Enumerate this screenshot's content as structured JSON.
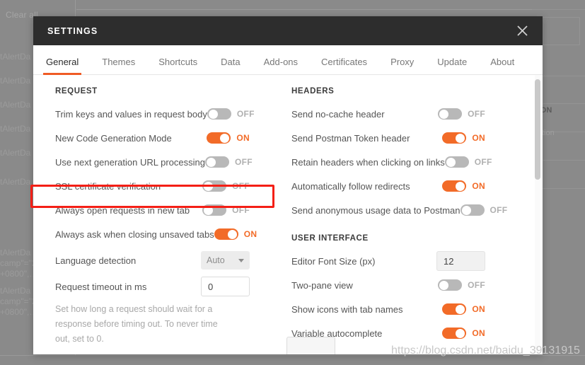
{
  "background": {
    "clear_all_label": "Clear all",
    "log_lines": [
      "tAlertDa",
      "tAlertDa",
      "tAlertDa",
      "tAlertDa",
      "tAlertDa",
      "tAlertDa",
      "camp\"=\"2",
      "+0800\",…",
      "tAlertDa",
      "camp\"=\"2",
      "+0800\",…"
    ],
    "right_bold_text": "TION",
    "right_norm_text": "tion"
  },
  "modal": {
    "title": "SETTINGS",
    "close_icon": "close-icon",
    "tabs": [
      {
        "label": "General",
        "active": true
      },
      {
        "label": "Themes",
        "active": false
      },
      {
        "label": "Shortcuts",
        "active": false
      },
      {
        "label": "Data",
        "active": false
      },
      {
        "label": "Add-ons",
        "active": false
      },
      {
        "label": "Certificates",
        "active": false
      },
      {
        "label": "Proxy",
        "active": false
      },
      {
        "label": "Update",
        "active": false
      },
      {
        "label": "About",
        "active": false
      }
    ],
    "left_column": {
      "section_title": "REQUEST",
      "rows": [
        {
          "label": "Trim keys and values in request body",
          "type": "toggle",
          "state": "OFF"
        },
        {
          "label": "New Code Generation Mode",
          "type": "toggle",
          "state": "ON"
        },
        {
          "label": "Use next generation URL processing",
          "type": "toggle",
          "state": "OFF"
        },
        {
          "label": "SSL certificate verification",
          "type": "toggle",
          "state": "OFF",
          "highlighted": true
        },
        {
          "label": "Always open requests in new tab",
          "type": "toggle",
          "state": "OFF"
        },
        {
          "label": "Always ask when closing unsaved tabs",
          "type": "toggle",
          "state": "ON"
        },
        {
          "label": "Language detection",
          "type": "select",
          "value": "Auto"
        },
        {
          "label": "Request timeout in ms",
          "type": "input",
          "value": "0"
        }
      ],
      "help_text": "Set how long a request should wait for a response before timing out. To never time out, set to 0."
    },
    "right_column": {
      "sections": [
        {
          "section_title": "HEADERS",
          "rows": [
            {
              "label": "Send no-cache header",
              "type": "toggle",
              "state": "OFF"
            },
            {
              "label": "Send Postman Token header",
              "type": "toggle",
              "state": "ON"
            },
            {
              "label": "Retain headers when clicking on links",
              "type": "toggle",
              "state": "OFF"
            },
            {
              "label": "Automatically follow redirects",
              "type": "toggle",
              "state": "ON"
            },
            {
              "label": "Send anonymous usage data to Postman",
              "type": "toggle",
              "state": "OFF"
            }
          ]
        },
        {
          "section_title": "USER INTERFACE",
          "rows": [
            {
              "label": "Editor Font Size (px)",
              "type": "input",
              "value": "12"
            },
            {
              "label": "Two-pane view",
              "type": "toggle",
              "state": "OFF"
            },
            {
              "label": "Show icons with tab names",
              "type": "toggle",
              "state": "ON"
            },
            {
              "label": "Variable autocomplete",
              "type": "toggle",
              "state": "ON"
            }
          ]
        }
      ]
    }
  },
  "watermark": "https://blog.csdn.net/baidu_39131915",
  "colors": {
    "accent": "#f26b28",
    "tab_underline": "#ef5b25",
    "header_bg": "#2d2d2d",
    "highlight": "#f41f16",
    "toggle_off": "#b8b8b8"
  }
}
